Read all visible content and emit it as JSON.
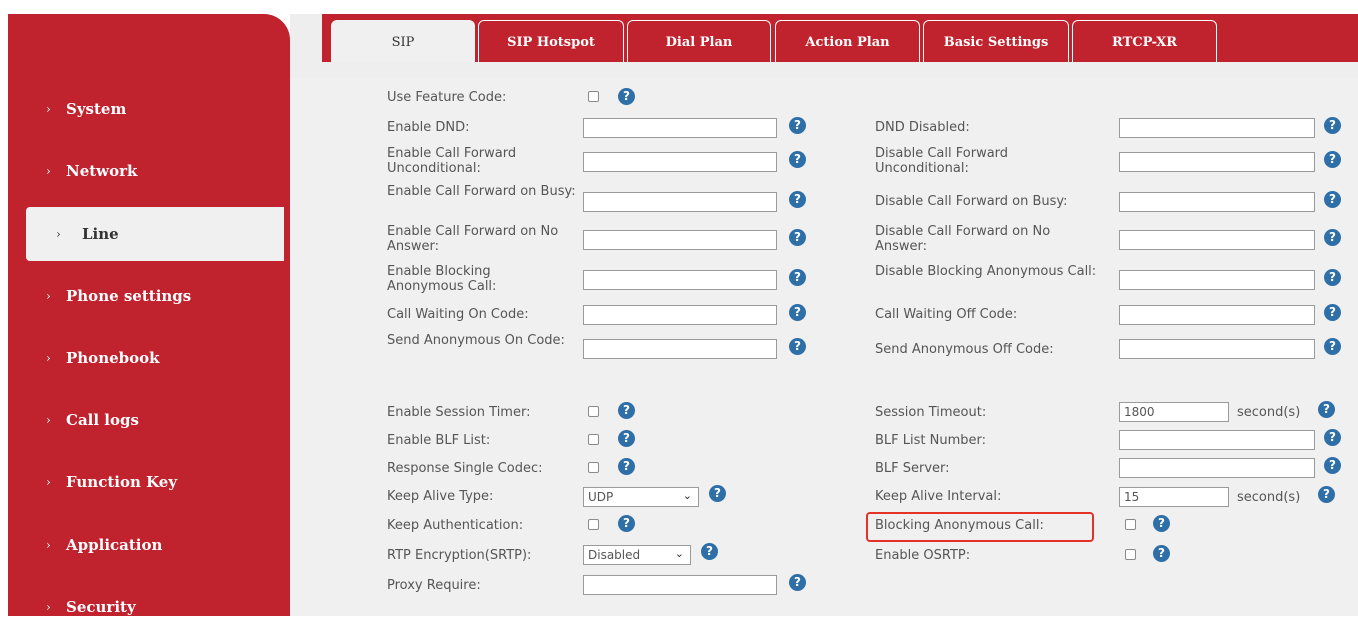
{
  "sidebar": {
    "items": [
      {
        "label": "System"
      },
      {
        "label": "Network"
      },
      {
        "label": "Line"
      },
      {
        "label": "Phone settings"
      },
      {
        "label": "Phonebook"
      },
      {
        "label": "Call logs"
      },
      {
        "label": "Function Key"
      },
      {
        "label": "Application"
      },
      {
        "label": "Security"
      }
    ],
    "active": "Line",
    "chevron": "›"
  },
  "tabs": [
    {
      "label": "SIP",
      "active": true
    },
    {
      "label": "SIP Hotspot"
    },
    {
      "label": "Dial Plan"
    },
    {
      "label": "Action Plan"
    },
    {
      "label": "Basic Settings"
    },
    {
      "label": "RTCP-XR"
    }
  ],
  "form": {
    "help_glyph": "?",
    "use_feature_code": {
      "label": "Use Feature Code:",
      "checked": false
    },
    "enable_dnd": {
      "label": "Enable DND:",
      "value": ""
    },
    "dnd_disabled": {
      "label": "DND Disabled:",
      "value": ""
    },
    "enable_cf_unconditional": {
      "label": "Enable Call Forward Unconditional:",
      "value": ""
    },
    "disable_cf_unconditional": {
      "label": "Disable Call Forward Unconditional:",
      "value": ""
    },
    "enable_cf_busy": {
      "label": "Enable Call Forward on Busy:",
      "value": ""
    },
    "disable_cf_busy": {
      "label": "Disable Call Forward on Busy:",
      "value": ""
    },
    "enable_cf_noanswer": {
      "label": "Enable Call Forward on No Answer:",
      "value": ""
    },
    "disable_cf_noanswer": {
      "label": "Disable Call Forward on No Answer:",
      "value": ""
    },
    "enable_blocking_anon": {
      "label": "Enable Blocking Anonymous Call:",
      "value": ""
    },
    "disable_blocking_anon": {
      "label": "Disable Blocking Anonymous Call:",
      "value": ""
    },
    "cw_on": {
      "label": "Call Waiting On Code:",
      "value": ""
    },
    "cw_off": {
      "label": "Call Waiting Off Code:",
      "value": ""
    },
    "send_anon_on": {
      "label": "Send Anonymous On Code:",
      "value": ""
    },
    "send_anon_off": {
      "label": "Send Anonymous Off Code:",
      "value": ""
    },
    "session_timer": {
      "label": "Enable Session Timer:",
      "checked": false
    },
    "session_timeout": {
      "label": "Session Timeout:",
      "value": "1800",
      "unit": "second(s)"
    },
    "blf_list": {
      "label": "Enable BLF List:",
      "checked": false
    },
    "blf_list_number": {
      "label": "BLF List Number:",
      "value": ""
    },
    "response_single_codec": {
      "label": "Response Single Codec:",
      "checked": false
    },
    "blf_server": {
      "label": "BLF Server:",
      "value": ""
    },
    "keep_alive_type": {
      "label": "Keep Alive Type:",
      "value": "UDP"
    },
    "keep_alive_interval": {
      "label": "Keep Alive Interval:",
      "value": "15",
      "unit": "second(s)"
    },
    "keep_auth": {
      "label": "Keep Authentication:",
      "checked": false
    },
    "blocking_anon": {
      "label": "Blocking Anonymous Call:",
      "checked": false
    },
    "rtp_encryption": {
      "label": "RTP Encryption(SRTP):",
      "value": "Disabled"
    },
    "enable_osrtp": {
      "label": "Enable OSRTP:",
      "checked": false
    },
    "proxy_require": {
      "label": "Proxy Require:",
      "value": ""
    }
  },
  "colors": {
    "brand": "#c0222e",
    "panel": "#f0f0f0",
    "help": "#2e6fa8",
    "highlight": "#e4322b"
  },
  "icons": {
    "help": "question-circle-icon",
    "chevron": "chevron-right-icon",
    "dropdown": "chevron-down-icon"
  }
}
